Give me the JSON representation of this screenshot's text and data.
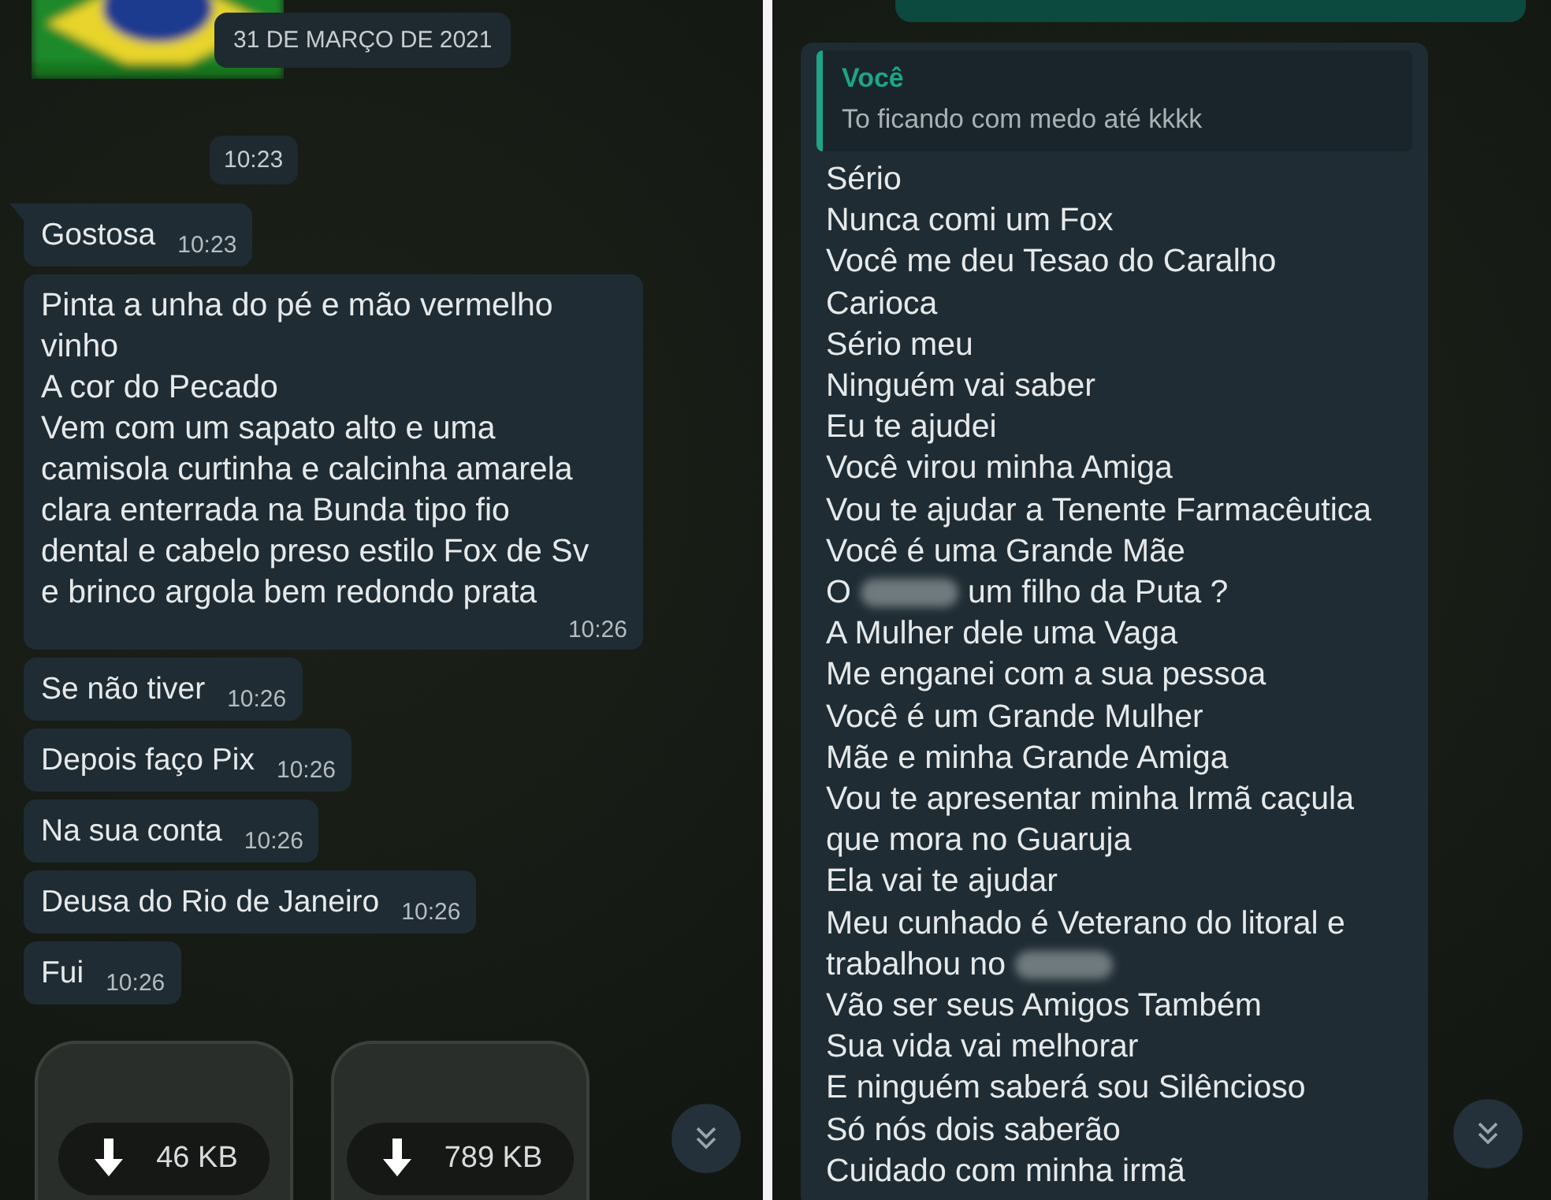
{
  "left_chat": {
    "date_chip": "31 DE MARÇO DE 2021",
    "time_chip": "10:23",
    "messages": [
      {
        "text": "Gostosa",
        "time": "10:23",
        "tail": true
      },
      {
        "text": "Pinta a unha do pé e mão vermelho\nvinho\nA cor do Pecado\nVem com um sapato alto e uma\ncamisola curtinha e calcinha amarela\nclara enterrada na Bunda tipo fio\ndental e cabelo preso estilo Fox de Sv\ne brinco argola bem redondo prata",
        "time": "10:26",
        "tail": false
      },
      {
        "text": "Se não tiver",
        "time": "10:26",
        "tail": false
      },
      {
        "text": "Depois faço Pix",
        "time": "10:26",
        "tail": false
      },
      {
        "text": "Na sua conta",
        "time": "10:26",
        "tail": false
      },
      {
        "text": "Deusa do Rio de Janeiro",
        "time": "10:26",
        "tail": false
      },
      {
        "text": "Fui",
        "time": "10:26",
        "tail": false
      }
    ],
    "attachments": [
      {
        "size": "46 KB"
      },
      {
        "size": "789 KB"
      }
    ]
  },
  "right_chat": {
    "quote": {
      "author": "Você",
      "text": "To ficando com medo até kkkk"
    },
    "lines": [
      {
        "kind": "text",
        "text": "Sério"
      },
      {
        "kind": "text",
        "text": "Nunca comi um Fox"
      },
      {
        "kind": "text",
        "text": "Você me deu Tesao do Caralho"
      },
      {
        "kind": "text",
        "text": "Carioca"
      },
      {
        "kind": "text",
        "text": "Sério meu"
      },
      {
        "kind": "text",
        "text": "Ninguém vai saber"
      },
      {
        "kind": "text",
        "text": "Eu te ajudei"
      },
      {
        "kind": "text",
        "text": "Você virou minha Amiga"
      },
      {
        "kind": "text",
        "text": "Vou te ajudar a Tenente Farmacêutica"
      },
      {
        "kind": "text",
        "text": "Você é uma Grande Mãe"
      },
      {
        "kind": "redacted",
        "before": "O",
        "after": "um filho da Puta ?"
      },
      {
        "kind": "text",
        "text": "A Mulher dele uma Vaga"
      },
      {
        "kind": "text",
        "text": "Me enganei com a sua pessoa"
      },
      {
        "kind": "text",
        "text": "Você é um Grande Mulher"
      },
      {
        "kind": "text",
        "text": "Mãe e minha Grande Amiga"
      },
      {
        "kind": "text",
        "text": "Vou te apresentar minha Irmã caçula"
      },
      {
        "kind": "text",
        "text": "que mora no Guaruja"
      },
      {
        "kind": "text",
        "text": "Ela vai te ajudar"
      },
      {
        "kind": "text",
        "text": "Meu cunhado é Veterano do litoral e"
      },
      {
        "kind": "redacted",
        "before": "trabalhou no"
      },
      {
        "kind": "text",
        "text": "Vão ser seus Amigos Também"
      },
      {
        "kind": "text",
        "text": "Sua vida vai melhorar"
      },
      {
        "kind": "text",
        "text": "E ninguém saberá sou Silêncioso"
      },
      {
        "kind": "text",
        "text": "Só nós dois saberão"
      },
      {
        "kind": "text",
        "text": "Cuidado com minha irmã"
      }
    ]
  }
}
